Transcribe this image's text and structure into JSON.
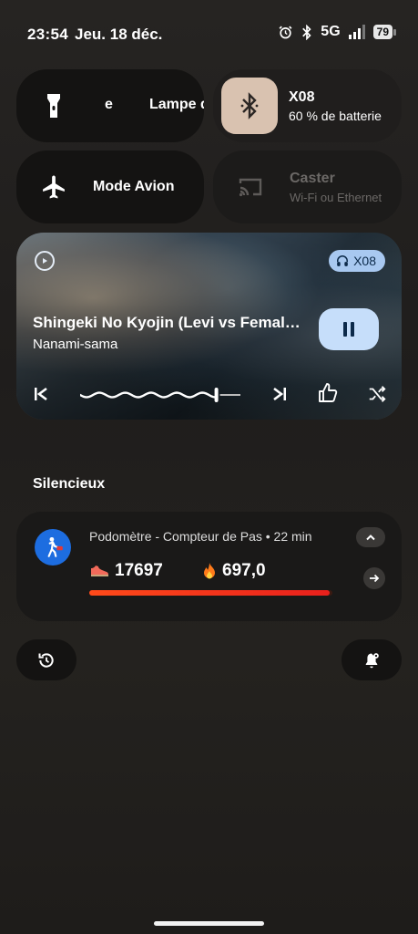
{
  "status_bar": {
    "time": "23:54",
    "date": "Jeu. 18 déc.",
    "network": "5G",
    "battery": "79"
  },
  "tiles": {
    "flashlight": {
      "short_label": "e",
      "label": "Lampe de poche"
    },
    "bluetooth": {
      "title": "X08",
      "subtitle": "60 % de batterie"
    },
    "airplane": {
      "label": "Mode Avion"
    },
    "cast": {
      "title": "Caster",
      "subtitle": "Wi-Fi ou Ethernet"
    }
  },
  "media": {
    "device": "X08",
    "title": "Shingeki No Kyojin (Levi vs Female Titan)",
    "artist": "Nanami-sama",
    "progress": 0.85
  },
  "notifications": {
    "section_label": "Silencieux",
    "pedometer": {
      "header": "Podomètre - Compteur de Pas • 22 min",
      "steps": "17697",
      "calories": "697,0",
      "progress": 0.99
    }
  },
  "colors": {
    "accent_blue": "#a8c8f0",
    "bluetooth_tile": "#d9c2b0",
    "progress_red": "#e8201c"
  },
  "icons": {
    "flashlight": "flashlight-icon",
    "bluetooth": "bluetooth-icon",
    "airplane": "airplane-icon",
    "cast": "cast-icon",
    "history": "history-icon",
    "notification_settings": "notification-settings-icon"
  }
}
